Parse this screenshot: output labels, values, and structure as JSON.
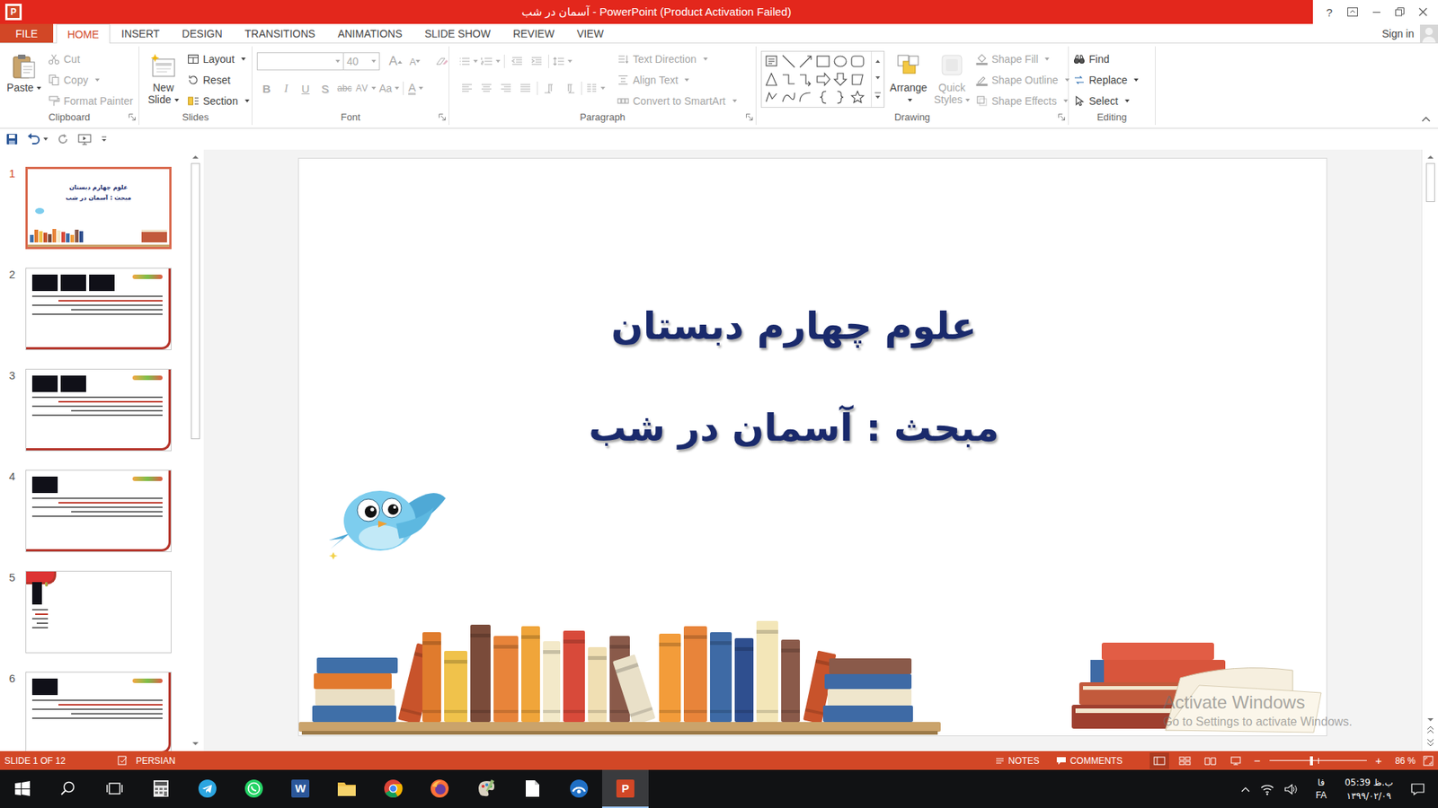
{
  "window": {
    "app_letter": "P",
    "title": "آسمان در شب - PowerPoint (Product Activation Failed)",
    "help": "?"
  },
  "ribbon": {
    "tabs": [
      {
        "label": "FILE",
        "kind": "file",
        "selected": false
      },
      {
        "label": "HOME",
        "kind": "tab",
        "selected": true
      },
      {
        "label": "INSERT",
        "kind": "tab",
        "selected": false
      },
      {
        "label": "DESIGN",
        "kind": "tab",
        "selected": false
      },
      {
        "label": "TRANSITIONS",
        "kind": "tab",
        "selected": false
      },
      {
        "label": "ANIMATIONS",
        "kind": "tab",
        "selected": false
      },
      {
        "label": "SLIDE SHOW",
        "kind": "tab",
        "selected": false
      },
      {
        "label": "REVIEW",
        "kind": "tab",
        "selected": false
      },
      {
        "label": "VIEW",
        "kind": "tab",
        "selected": false
      }
    ],
    "sign_in": "Sign in",
    "groups": [
      {
        "kind": "clipboard",
        "name": "Clipboard",
        "launcher": true,
        "gallery": false,
        "large": [
          {
            "label": "Paste",
            "kind": "paste",
            "disabled": false,
            "dropdown": true
          }
        ],
        "small": [
          {
            "label": "Cut",
            "kind": "cut",
            "disabled": true,
            "dropdown": false
          },
          {
            "label": "Copy",
            "kind": "copy",
            "disabled": true,
            "dropdown": true
          },
          {
            "label": "Format Painter",
            "kind": "painter",
            "disabled": true,
            "dropdown": false
          }
        ]
      },
      {
        "kind": "slides",
        "name": "Slides",
        "launcher": false,
        "gallery": false,
        "large": [
          {
            "label": "New Slide",
            "kind": "new-slide",
            "disabled": false,
            "dropdown": true
          }
        ],
        "small": [
          {
            "label": "Layout",
            "kind": "layout",
            "disabled": false,
            "dropdown": true
          },
          {
            "label": "Reset",
            "kind": "reset",
            "disabled": false,
            "dropdown": false
          },
          {
            "label": "Section",
            "kind": "section",
            "disabled": false,
            "dropdown": true
          }
        ]
      },
      {
        "kind": "font",
        "name": "Font",
        "launcher": true,
        "gallery": false,
        "font": {
          "name": "",
          "size": "40",
          "disabled": true,
          "row1": [
            {
              "label": "A",
              "kind": "grow",
              "dropdown": false
            },
            {
              "label": "A",
              "kind": "shrink",
              "dropdown": false
            }
          ],
          "row2": [
            {
              "label": "B",
              "kind": "bold",
              "dropdown": false
            },
            {
              "label": "I",
              "kind": "italic",
              "dropdown": false
            },
            {
              "label": "U",
              "kind": "underline",
              "dropdown": false
            },
            {
              "label": "S",
              "kind": "shadow",
              "dropdown": false
            },
            {
              "label": "abc",
              "kind": "strike",
              "dropdown": false
            },
            {
              "label": "AV",
              "kind": "spacing",
              "dropdown": true
            },
            {
              "label": "Aa",
              "kind": "case",
              "dropdown": true
            },
            {
              "label": "A",
              "kind": "color",
              "dropdown": true
            }
          ]
        },
        "large": [],
        "small": []
      },
      {
        "kind": "paragraph",
        "name": "Paragraph",
        "launcher": true,
        "gallery": false,
        "large": [],
        "small": [
          {
            "label": "Text Direction",
            "kind": "text-direction",
            "disabled": true,
            "dropdown": true
          },
          {
            "label": "Align Text",
            "kind": "align-text",
            "disabled": true,
            "dropdown": true
          },
          {
            "label": "Convert to SmartArt",
            "kind": "smartart",
            "disabled": true,
            "dropdown": true
          }
        ]
      },
      {
        "kind": "drawing",
        "name": "Drawing",
        "launcher": true,
        "gallery": true,
        "large": [
          {
            "label": "Arrange",
            "kind": "arrange",
            "disabled": false,
            "dropdown": true
          },
          {
            "label": "Quick Styles",
            "kind": "quick-styles",
            "disabled": true,
            "dropdown": true
          }
        ],
        "small": [
          {
            "label": "Shape Fill",
            "kind": "fill",
            "disabled": true,
            "dropdown": true
          },
          {
            "label": "Shape Outline",
            "kind": "outline",
            "disabled": true,
            "dropdown": true
          },
          {
            "label": "Shape Effects",
            "kind": "effects",
            "disabled": true,
            "dropdown": true
          }
        ]
      },
      {
        "kind": "editing",
        "name": "Editing",
        "launcher": false,
        "gallery": false,
        "large": [],
        "small": [
          {
            "label": "Find",
            "kind": "find",
            "disabled": false,
            "dropdown": false
          },
          {
            "label": "Replace",
            "kind": "replace",
            "disabled": false,
            "dropdown": true
          },
          {
            "label": "Select",
            "kind": "select",
            "disabled": false,
            "dropdown": true
          }
        ]
      }
    ]
  },
  "thumbnails": {
    "scroll_level": 0.48,
    "slides": [
      {
        "number": "1",
        "selected": true,
        "kind": "title",
        "lines": [
          "علوم چهارم دبستان",
          "مبحث : آسمان در شب"
        ],
        "photos": 0
      },
      {
        "number": "2",
        "selected": false,
        "kind": "content",
        "lines": [],
        "photos": 3
      },
      {
        "number": "3",
        "selected": false,
        "kind": "content",
        "lines": [],
        "photos": 2
      },
      {
        "number": "4",
        "selected": false,
        "kind": "content",
        "lines": [],
        "photos": 1
      },
      {
        "number": "5",
        "selected": false,
        "kind": "heading",
        "lines": [],
        "photos": 1
      },
      {
        "number": "6",
        "selected": false,
        "kind": "content",
        "lines": [],
        "photos": 1
      }
    ]
  },
  "slide": {
    "title": "علوم چهارم دبستان",
    "subtitle": "مبحث : آسمان در شب"
  },
  "canvas_scroll": {
    "level": 0.07
  },
  "watermark": {
    "title": "Activate Windows",
    "subtitle": "Go to Settings to activate Windows."
  },
  "status_bar": {
    "slide": "SLIDE 1 OF 12",
    "language": "PERSIAN",
    "notes": "NOTES",
    "comments": "COMMENTS",
    "views": [
      {
        "kind": "normal",
        "selected": true
      },
      {
        "kind": "sorter",
        "selected": false
      },
      {
        "kind": "reading",
        "selected": false
      },
      {
        "kind": "show",
        "selected": false
      }
    ],
    "zoom_out": "−",
    "zoom_in": "+",
    "zoom": "86 %",
    "zoom_level": 0.43
  },
  "taskbar": {
    "apps": [
      {
        "kind": "start",
        "selected": false
      },
      {
        "kind": "search",
        "selected": false
      },
      {
        "kind": "taskview",
        "selected": false
      },
      {
        "kind": "calculator",
        "selected": false
      },
      {
        "kind": "telegram",
        "selected": false
      },
      {
        "kind": "whatsapp",
        "selected": false
      },
      {
        "kind": "word",
        "glyph": "W",
        "selected": false
      },
      {
        "kind": "explorer",
        "selected": false
      },
      {
        "kind": "chrome",
        "selected": false
      },
      {
        "kind": "firefox",
        "selected": false
      },
      {
        "kind": "paint",
        "selected": false
      },
      {
        "kind": "file",
        "selected": false
      },
      {
        "kind": "dial",
        "selected": false
      },
      {
        "kind": "powerpoint",
        "glyph": "P",
        "selected": true
      }
    ],
    "tray": {
      "input_top": "فا",
      "input_bottom": "FA",
      "time": "ب.ظ 05:39",
      "date": "۱۳۹۹/۰۲/۰۹"
    }
  }
}
